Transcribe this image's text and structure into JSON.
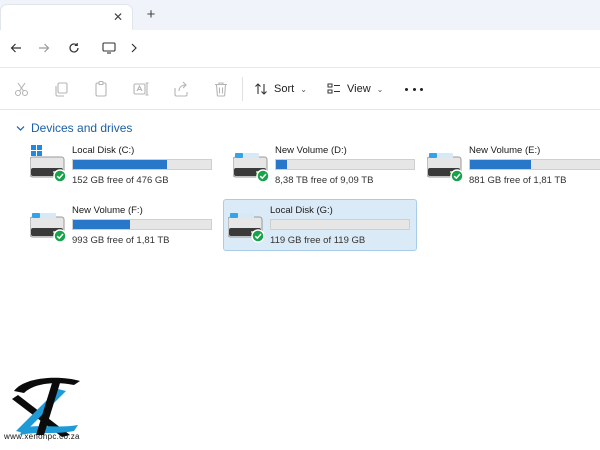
{
  "tabs": [
    {
      "label": "",
      "close_icon": "close-icon"
    }
  ],
  "new_tab_icon": "plus-icon",
  "nav": {
    "back_icon": "arrow-left-icon",
    "forward_icon": "arrow-right-icon",
    "refresh_icon": "refresh-icon",
    "location_icon": "monitor-icon",
    "breadcrumb_chevron_icon": "chevron-right-icon"
  },
  "command_bar": {
    "sort_label": "Sort",
    "view_label": "View",
    "icons": [
      "cut-icon",
      "copy-icon",
      "paste-icon",
      "rename-icon",
      "share-icon",
      "delete-icon",
      "sort-icon",
      "view-icon",
      "more-icon"
    ]
  },
  "section": {
    "title": "Devices and drives"
  },
  "drives": [
    {
      "name": "Local Disk (C:)",
      "free_text": "152 GB free of 476 GB",
      "used_fraction": 0.68,
      "status": "ok"
    },
    {
      "name": "New Volume (D:)",
      "free_text": "8,38 TB free of 9,09 TB",
      "used_fraction": 0.08,
      "status": "ok"
    },
    {
      "name": "New Volume (E:)",
      "free_text": "881 GB free of 1,81 TB",
      "used_fraction": 0.44,
      "status": "ok"
    },
    {
      "name": "New Volume (F:)",
      "free_text": "993 GB free of 1,81 TB",
      "used_fraction": 0.41,
      "status": "ok"
    },
    {
      "name": "Local Disk (G:)",
      "free_text": "119 GB free of 119 GB",
      "used_fraction": 0.0,
      "status": "ok",
      "selected": true
    }
  ],
  "colors": {
    "accent": "#2877c9",
    "status_ok": "#16a34a",
    "selection": "#dbeaf7"
  },
  "watermark": {
    "url": "www.xenonpc.co.za"
  }
}
